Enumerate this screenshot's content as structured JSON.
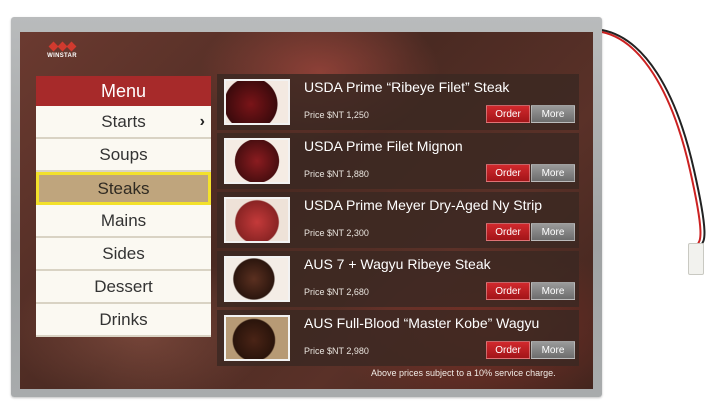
{
  "logo": {
    "brand": "WINSTAR"
  },
  "menu": {
    "header": "Menu",
    "items": [
      {
        "label": "Starts",
        "chevron": "›"
      },
      {
        "label": "Soups"
      },
      {
        "label": "Steaks",
        "selected": true
      },
      {
        "label": "Mains"
      },
      {
        "label": "Sides"
      },
      {
        "label": "Dessert"
      },
      {
        "label": "Drinks"
      }
    ]
  },
  "products": [
    {
      "title": "USDA Prime “Ribeye Filet” Steak",
      "price": "Price $NT 1,250",
      "order": "Order",
      "more": "More"
    },
    {
      "title": "USDA Prime Filet Mignon",
      "price": "Price $NT 1,880",
      "order": "Order",
      "more": "More"
    },
    {
      "title": "USDA Prime Meyer Dry-Aged Ny Strip",
      "price": "Price $NT 2,300",
      "order": "Order",
      "more": "More"
    },
    {
      "title": "AUS 7 + Wagyu Ribeye Steak",
      "price": "Price $NT 2,680",
      "order": "Order",
      "more": "More"
    },
    {
      "title": "AUS Full-Blood “Master Kobe” Wagyu",
      "price": "Price $NT 2,980",
      "order": "Order",
      "more": "More"
    }
  ],
  "footer_note": "Above prices subject to a 10% service charge.",
  "colors": {
    "menu_header": "#a72a2a",
    "selected_item": "#bfa57d",
    "selected_border": "#f3e12c",
    "order_button": "#c5242a",
    "more_button": "#8a8a8a"
  }
}
